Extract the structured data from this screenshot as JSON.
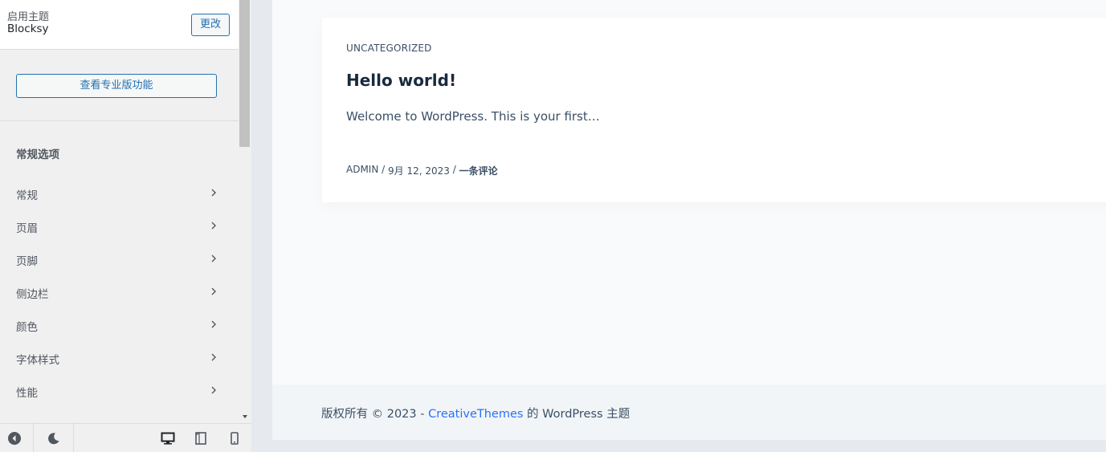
{
  "sidebar": {
    "theme_label": "启用主题",
    "theme_name": "Blocksy",
    "change_button": "更改",
    "pro_button": "查看专业版功能",
    "section_title": "常规选项",
    "items": [
      {
        "label": "常规"
      },
      {
        "label": "页眉"
      },
      {
        "label": "页脚"
      },
      {
        "label": "侧边栏"
      },
      {
        "label": "颜色"
      },
      {
        "label": "字体样式"
      },
      {
        "label": "性能"
      }
    ],
    "footer_icons": [
      "hide-controls-icon",
      "dark-mode-icon",
      "desktop-icon",
      "tablet-icon",
      "mobile-icon"
    ]
  },
  "post": {
    "category": "UNCATEGORIZED",
    "title": "Hello world!",
    "excerpt": "Welcome to WordPress. This is your first…",
    "author": "ADMIN",
    "sep": " / ",
    "date": "9月 12, 2023",
    "comments": "一条评论"
  },
  "site_footer": {
    "prefix": "版权所有 © 2023 - ",
    "link": "CreativeThemes",
    "suffix": " 的 WordPress 主题"
  },
  "colors": {
    "accent": "#2271b1",
    "link": "#2872fa",
    "heading": "#192a3d"
  }
}
